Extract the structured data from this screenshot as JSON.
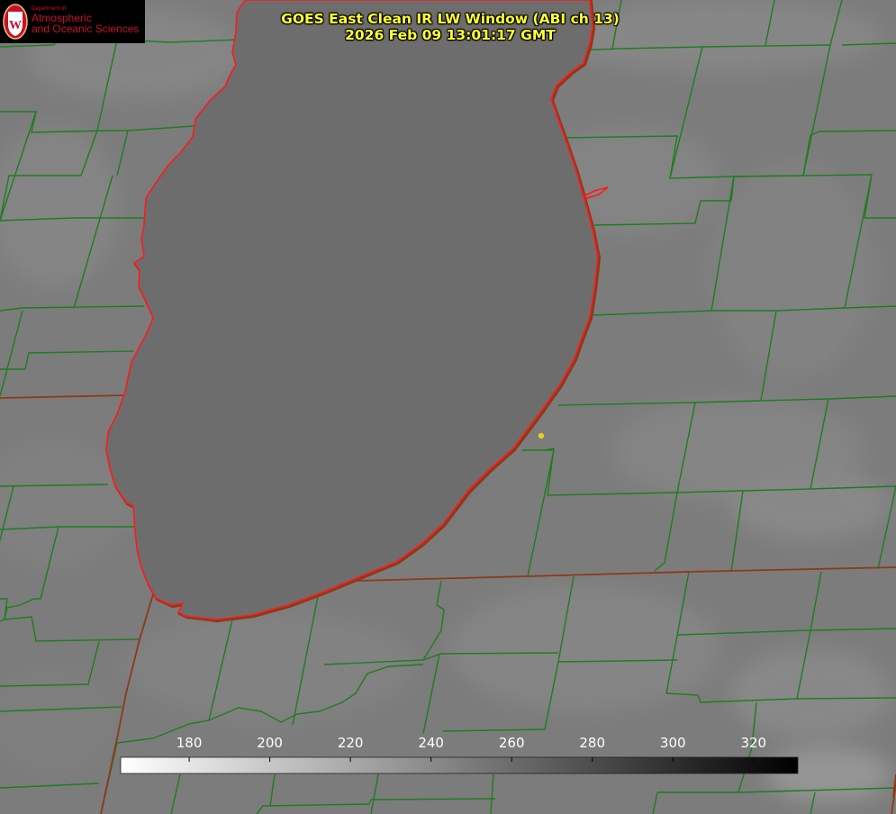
{
  "logo": {
    "department": "Department of",
    "line1": "Atmospheric",
    "line2": "and Oceanic Sciences",
    "seal_letter": "W"
  },
  "title": {
    "line1": "GOES East Clean IR LW Window (ABI ch 13)",
    "line2": "2026 Feb 09 13:01:17 GMT"
  },
  "colorbar": {
    "ticks": [
      "180",
      "200",
      "220",
      "240",
      "260",
      "280",
      "300",
      "320"
    ],
    "tick_values": [
      180,
      200,
      220,
      240,
      260,
      280,
      300,
      320
    ],
    "range": [
      163,
      331
    ],
    "color_low": "#ffffff",
    "color_high": "#000000"
  },
  "colors": {
    "county_lines": "#1e7d1e",
    "state_lines": "#8b3a1a",
    "lake_shoreline": "#ff1a1a",
    "station_marker": "#e6d21e",
    "title_text": "#ffff33",
    "logo_text": "#c8102e",
    "background": "#7b7b7b"
  },
  "icons": {
    "seal": "uw-crest-icon",
    "marker": "station-dot-icon"
  }
}
